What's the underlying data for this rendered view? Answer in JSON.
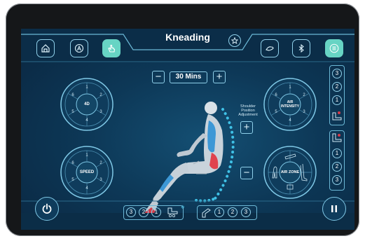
{
  "header": {
    "title": "Kneading"
  },
  "timer": {
    "minus_label": "−",
    "value": "30 Mins",
    "plus_label": "+"
  },
  "dials": {
    "fourd": {
      "label": "4D",
      "numbers": [
        "1",
        "2",
        "3",
        "4",
        "5",
        "6"
      ]
    },
    "speed": {
      "label": "SPEED",
      "numbers": [
        "1",
        "2",
        "3",
        "4",
        "5",
        "6"
      ]
    },
    "air_intensity": {
      "label": "AIR\nINTENSITY",
      "numbers": [
        "1",
        "2",
        "3",
        "4",
        "5",
        "6"
      ]
    },
    "air_zone": {
      "label": "AIR ZONE"
    }
  },
  "shoulder": {
    "label": "Shoulder\nPosition\nAdjustment",
    "plus_label": "+",
    "minus_label": "−"
  },
  "right_upper_column": [
    "3",
    "2",
    "1"
  ],
  "right_lower_column": [
    "1",
    "2",
    "3"
  ],
  "bottom_left_strip": [
    "3",
    "2",
    "1"
  ],
  "bottom_right_strip": [
    "1",
    "2",
    "3"
  ],
  "colors": {
    "accent": "#67d4c4",
    "outline": "#8fd0ea",
    "background": "#0d3857",
    "red_indicator": "#d63a4a"
  }
}
